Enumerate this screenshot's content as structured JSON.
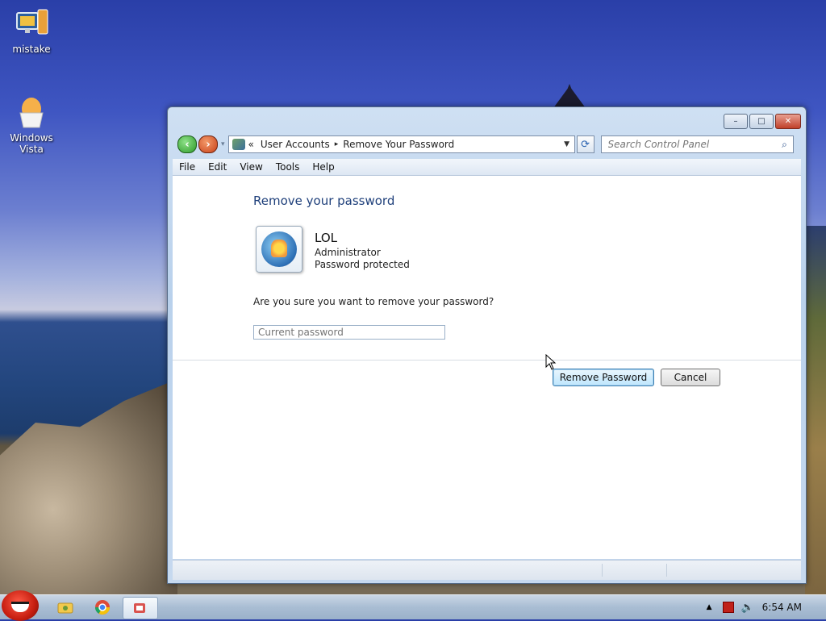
{
  "desktop": {
    "icons": [
      {
        "label": "mistake",
        "icon": "monitor-icon"
      },
      {
        "label": "Windows\nVista",
        "icon": "egg-icon"
      }
    ]
  },
  "window": {
    "breadcrumb": {
      "parent": "User Accounts",
      "current": "Remove Your Password",
      "chevron": "«",
      "separator": "▸"
    },
    "search_placeholder": "Search Control Panel",
    "menu": [
      "File",
      "Edit",
      "View",
      "Tools",
      "Help"
    ],
    "caption_buttons": {
      "minimize": "–",
      "maximize": "□",
      "close": "✕"
    }
  },
  "content": {
    "heading": "Remove your password",
    "user": {
      "name": "LOL",
      "role": "Administrator",
      "status": "Password protected"
    },
    "question": "Are you sure you want to remove your password?",
    "password_placeholder": "Current password",
    "buttons": {
      "remove": "Remove Password",
      "cancel": "Cancel"
    }
  },
  "taskbar": {
    "clock": "6:54 AM"
  },
  "colors": {
    "heading": "#1e3f7a",
    "accent": "#3c7fb1"
  }
}
